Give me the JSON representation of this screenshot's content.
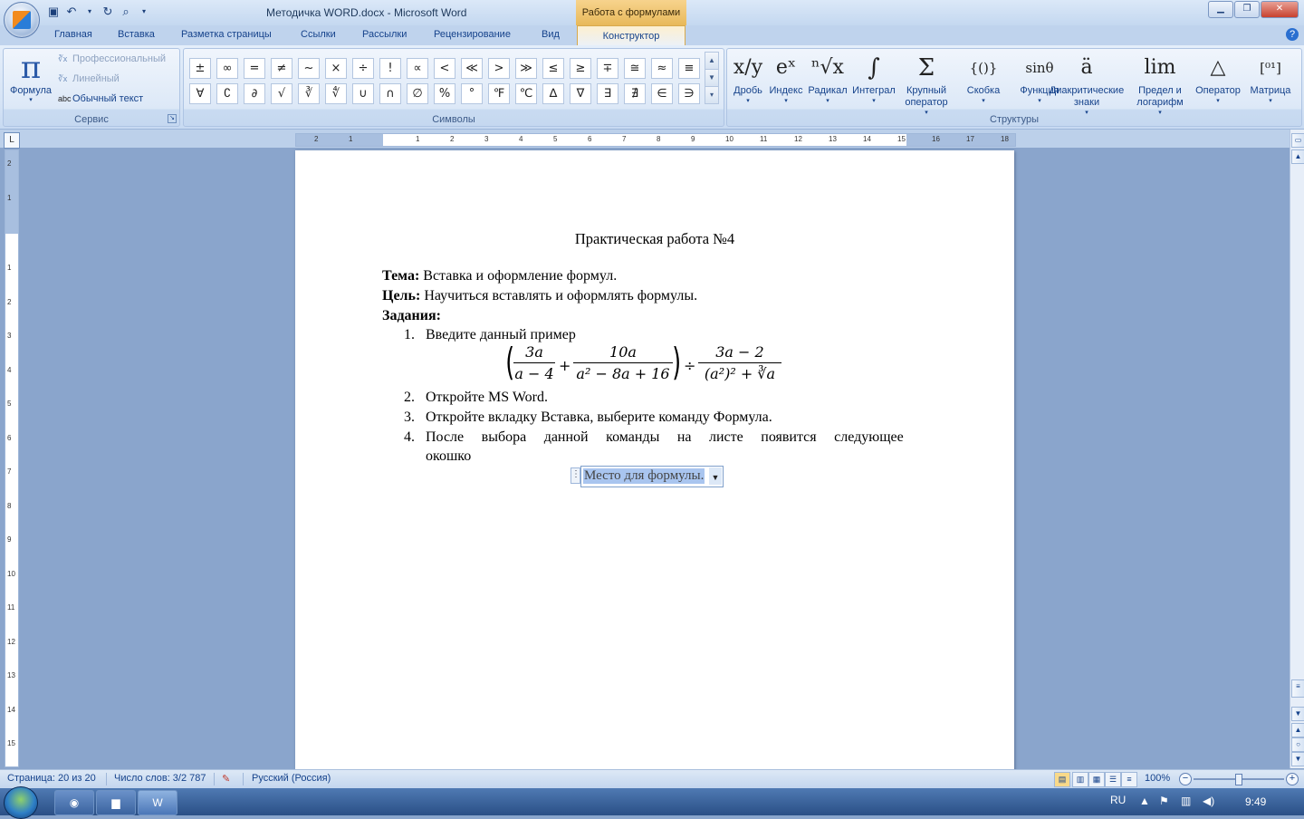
{
  "window": {
    "title": "Методичка WORD.docx - Microsoft Word",
    "context_tab_title": "Работа с формулами"
  },
  "quick_access": {
    "save_icon": "save-icon",
    "undo_icon": "undo-icon",
    "redo_icon": "redo-icon",
    "preview_icon": "print-preview-icon"
  },
  "ribbon_tabs": [
    "Главная",
    "Вставка",
    "Разметка страницы",
    "Ссылки",
    "Рассылки",
    "Рецензирование",
    "Вид"
  ],
  "active_tab": "Конструктор",
  "service_group": {
    "label": "Сервис",
    "formula_label": "Формула",
    "items": [
      "Профессиональный",
      "Линейный",
      "Обычный текст"
    ]
  },
  "symbols_group": {
    "label": "Символы",
    "row1": [
      "±",
      "∞",
      "=",
      "≠",
      "~",
      "×",
      "÷",
      "!",
      "∝",
      "<",
      "≪",
      ">",
      "≫",
      "≤",
      "≥",
      "∓",
      "≅",
      "≈",
      "≡"
    ],
    "row2": [
      "∀",
      "∁",
      "∂",
      "√",
      "∛",
      "∜",
      "∪",
      "∩",
      "∅",
      "%",
      "°",
      "℉",
      "℃",
      "∆",
      "∇",
      "∃",
      "∄",
      "∈",
      "∋"
    ]
  },
  "structures_group": {
    "label": "Структуры",
    "items": [
      {
        "icon": "x/y",
        "label": "Дробь"
      },
      {
        "icon": "eˣ",
        "label": "Индекс"
      },
      {
        "icon": "ⁿ√x",
        "label": "Радикал"
      },
      {
        "icon": "∫",
        "label": "Интеграл"
      },
      {
        "icon": "Σ",
        "label": "Крупный оператор"
      },
      {
        "icon": "{()}",
        "label": "Скобка"
      },
      {
        "icon": "sinθ",
        "label": "Функция"
      },
      {
        "icon": "ä",
        "label": "Диакритические знаки"
      },
      {
        "icon": "lim",
        "label": "Предел и логарифм"
      },
      {
        "icon": "△",
        "label": "Оператор"
      },
      {
        "icon": "[⁰¹]",
        "label": "Матрица"
      }
    ]
  },
  "ruler": {
    "h_numbers": [
      "2",
      "1",
      "1",
      "2",
      "3",
      "4",
      "5",
      "6",
      "7",
      "8",
      "9",
      "10",
      "11",
      "12",
      "13",
      "14",
      "15",
      "16",
      "17",
      "18"
    ],
    "v_numbers": [
      "2",
      "1",
      "1",
      "2",
      "3",
      "4",
      "5",
      "6",
      "7",
      "8",
      "9",
      "10",
      "11",
      "12",
      "13",
      "14",
      "15"
    ]
  },
  "document": {
    "heading": "Практическая работа №4",
    "topic_label": "Тема:",
    "topic_text": " Вставка и оформление формул.",
    "goal_label": "Цель:",
    "goal_text": " Научиться вставлять и оформлять формулы.",
    "tasks_label": "Задания:",
    "tasks": [
      {
        "num": "1.",
        "text": "Введите данный пример"
      },
      {
        "num": "2.",
        "text": "Откройте MS Word."
      },
      {
        "num": "3.",
        "text": "Откройте вкладку Вставка, выберите команду Формула."
      },
      {
        "num": "4.",
        "text": "После выбора данной команды на листе появится следующее"
      }
    ],
    "task4_cont": "окошко",
    "formula": {
      "f1_num": "3a",
      "f1_den": "a − 4",
      "plus": "+",
      "f2_num": "10a",
      "f2_den": "a² − 8a + 16",
      "div": "÷",
      "f3_num": "3a − 2",
      "f3_den": "(a²)² + ∛a"
    },
    "placeholder": "Место для формулы."
  },
  "status": {
    "page": "Страница: 20 из 20",
    "words": "Число слов: 3/2 787",
    "language": "Русский (Россия)",
    "zoom": "100%"
  },
  "taskbar": {
    "apps": [
      "chrome-icon",
      "explorer-icon",
      "word-icon"
    ],
    "lang": "RU",
    "time": "9:49"
  }
}
